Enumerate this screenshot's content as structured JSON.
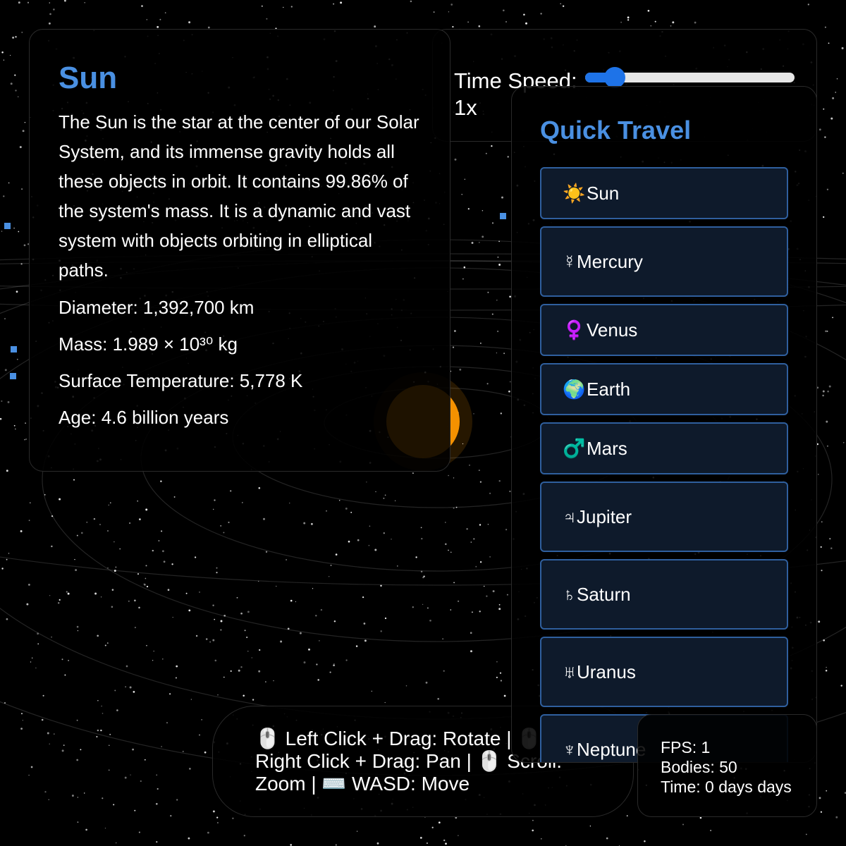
{
  "info": {
    "title": "Sun",
    "description": "The Sun is the star at the center of our Solar System, and its immense gravity holds all these objects in orbit. It contains 99.86% of the system's mass. It is a dynamic and vast system with objects orbiting in elliptical paths.",
    "stats": [
      "Diameter: 1,392,700 km",
      "Mass: 1.989 × 10³⁰ kg",
      "Surface Temperature: 5,778 K",
      "Age: 4.6 billion years"
    ]
  },
  "time_control": {
    "label": "Time Speed: 1x",
    "slider_fraction": 0.14
  },
  "quick_travel": {
    "title": "Quick Travel",
    "items": [
      {
        "symbol": "☀️",
        "label": "Sun",
        "active": true
      },
      {
        "symbol": "☿",
        "label": "Mercury",
        "active": false
      },
      {
        "symbol": "♀️",
        "label": "Venus",
        "active": false
      },
      {
        "symbol": "🌍",
        "label": "Earth",
        "active": false
      },
      {
        "symbol": "♂️",
        "label": "Mars",
        "active": false
      },
      {
        "symbol": "♃",
        "label": "Jupiter",
        "active": false
      },
      {
        "symbol": "♄",
        "label": "Saturn",
        "active": false
      },
      {
        "symbol": "♅",
        "label": "Uranus",
        "active": false
      },
      {
        "symbol": "♆",
        "label": "Neptune",
        "active": false
      }
    ]
  },
  "controls": {
    "text": "🖱️ Left Click + Drag: Rotate | 🖱️ Right Click + Drag: Pan | 🖱️ Scroll: Zoom | ⌨️ WASD: Move"
  },
  "stats": {
    "fps": "FPS: 1",
    "bodies": "Bodies: 50",
    "time": "Time: 0 days days"
  },
  "colors": {
    "accent": "#4a90e2",
    "active_button": "#3a7fd5",
    "button_bg": "#0e1a2b",
    "button_border": "#2f5f9e",
    "sun": "#ff9800"
  }
}
